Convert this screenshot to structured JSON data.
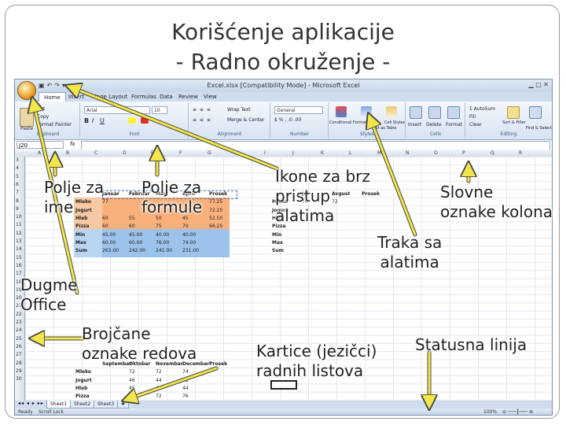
{
  "slide": {
    "title_line1": "Korišćenje aplikacije",
    "title_line2": "- Radno okruženje -"
  },
  "callouts": {
    "name_box": [
      "Polje za",
      "ime"
    ],
    "formula_bar": [
      "Polje za",
      "formule"
    ],
    "quick_access": [
      "Ikone za brz",
      "pristup",
      "alatima"
    ],
    "column_letters": [
      "Slovne",
      "oznake kolona"
    ],
    "ribbon": [
      "Traka sa",
      "alatima"
    ],
    "office_button": [
      "Dugme",
      "Office"
    ],
    "row_numbers": [
      "Brojčane",
      "oznake redova"
    ],
    "sheet_tabs": [
      "Kartice (jezičci)",
      "radnih listova"
    ],
    "status_bar": "Statusna linija"
  },
  "excel": {
    "window_title": "Excel.xlsx [Compatibility Mode] - Microsoft Excel",
    "tabs": [
      "Home",
      "Insert",
      "Page Layout",
      "Formulas",
      "Data",
      "Review",
      "View"
    ],
    "active_tab": "Home",
    "clipboard": {
      "paste": "Paste",
      "cut": "Cut",
      "copy": "Copy",
      "format_painter": "Format Painter",
      "label": "Clipboard"
    },
    "font": {
      "name": "Arial",
      "size": "10",
      "label": "Font"
    },
    "alignment": {
      "wrap": "Wrap Text",
      "merge": "Merge & Center",
      "label": "Alignment"
    },
    "number": {
      "format": "General",
      "label": "Number"
    },
    "styles": {
      "conditional": "Conditional Formatting",
      "table": "Format as Table",
      "cell": "Cell Styles",
      "label": "Styles"
    },
    "cells": {
      "insert": "Insert",
      "delete": "Delete",
      "format": "Format",
      "label": "Cells"
    },
    "editing": {
      "autosum": "AutoSum",
      "fill": "Fill",
      "clear": "Clear",
      "sort": "Sort & Filter",
      "find": "Find & Select",
      "label": "Editing"
    },
    "name_box_value": "J20",
    "columns": [
      "A",
      "B",
      "C",
      "D",
      "E",
      "F",
      "G",
      "H",
      "I",
      "J",
      "K",
      "L",
      "M",
      "N",
      "O",
      "P",
      "Q",
      "R"
    ],
    "rows": [
      "3",
      "4",
      "5",
      "6",
      "7",
      "8",
      "9",
      "10",
      "11",
      "12",
      "13",
      "14",
      "15",
      "16",
      "17",
      "18",
      "19",
      "20",
      "21",
      "22",
      "23",
      "24",
      "25",
      "26",
      "27",
      "28",
      "29",
      "30"
    ],
    "table1": {
      "headers": [
        "",
        "Januar",
        "Februar",
        "Mart",
        "April",
        "Prosek"
      ],
      "rows": [
        [
          "Mleko",
          "77",
          "",
          "",
          "",
          "77.25"
        ],
        [
          "Jogurt",
          "",
          "",
          "",
          "",
          "72.25"
        ],
        [
          "Hleb",
          "60",
          "55",
          "50",
          "45",
          "52.50"
        ],
        [
          "Pizza",
          "60",
          "60",
          "75",
          "70",
          "66.25"
        ],
        [
          "Min",
          "45.00",
          "45.00",
          "40.00",
          "40.00",
          ""
        ],
        [
          "Max",
          "60.00",
          "60.00",
          "76.00",
          "74.00",
          ""
        ],
        [
          "Sum",
          "263.00",
          "242.00",
          "241.00",
          "231.00",
          ""
        ]
      ]
    },
    "table2": {
      "headers": [
        "",
        "Jul",
        "Avgust",
        "Prosek"
      ],
      "rows": [
        [
          "Mleko",
          "70",
          "72",
          ""
        ],
        [
          "Jogurt",
          "",
          "",
          ""
        ],
        [
          "Hleb",
          "",
          "",
          ""
        ],
        [
          "Pizza",
          "",
          "",
          ""
        ],
        [
          "Min",
          "",
          "",
          ""
        ],
        [
          "Max",
          "",
          "",
          ""
        ],
        [
          "Sum",
          "",
          "",
          ""
        ]
      ]
    },
    "table3": {
      "headers": [
        "",
        "Septembar",
        "Oktobar",
        "Novembar",
        "Decembar",
        "Prosek"
      ],
      "rows": [
        [
          "Mleko",
          "",
          "72",
          "72",
          "74",
          ""
        ],
        [
          "Jogurt",
          "",
          "46",
          "44",
          "41",
          ""
        ],
        [
          "Hleb",
          "",
          "45",
          "44",
          "44",
          ""
        ],
        [
          "Pizza",
          "",
          "72",
          "72",
          "76",
          ""
        ],
        [
          "Min",
          "",
          "",
          "",
          "",
          ""
        ],
        [
          "Max",
          "",
          "",
          "",
          "",
          ""
        ],
        [
          "Sum",
          "",
          "",
          "",
          "",
          ""
        ]
      ]
    },
    "sheets": [
      "Sheet1",
      "Sheet2",
      "Sheet3"
    ],
    "active_sheet": "Sheet1",
    "status_left": "Ready",
    "status_scroll": "Scroll Lock",
    "zoom": "100%",
    "accent_color": "#e8a028",
    "callout_arrow_color": "#f2e64a"
  }
}
